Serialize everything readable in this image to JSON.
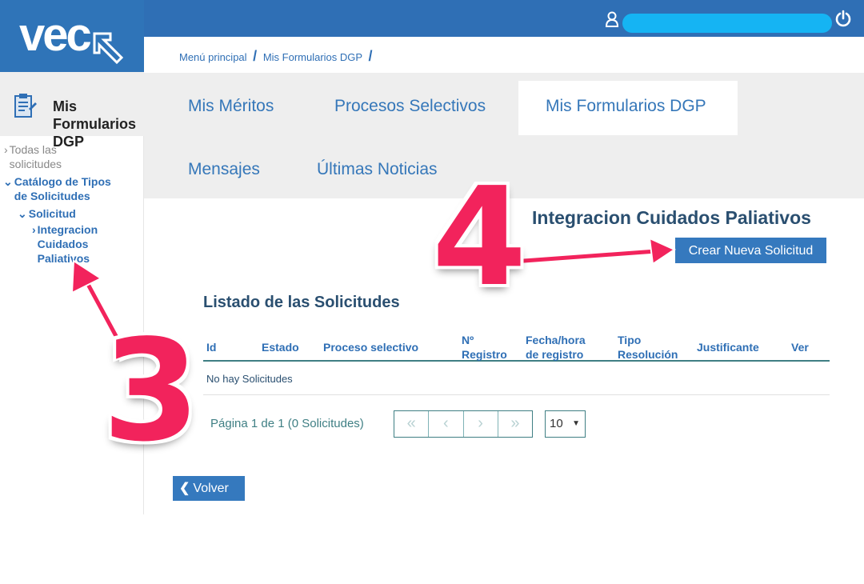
{
  "logo": {
    "text": "vec"
  },
  "sidebar": {
    "title": "Mis Formularios DGP",
    "items": [
      {
        "label": "Todas las solicitudes"
      },
      {
        "label": "Catálogo de Tipos de Solicitudes"
      },
      {
        "label": "Solicitud"
      },
      {
        "label": "Integracion Cuidados Paliativos"
      }
    ]
  },
  "breadcrumb": {
    "home": "Menú principal",
    "current": "Mis Formularios DGP",
    "sep": "/"
  },
  "tabs": [
    "Mis Méritos",
    "Procesos Selectivos",
    "Mis Formularios DGP",
    "Mensajes",
    "Últimas Noticias"
  ],
  "form": {
    "title": "Integracion Cuidados Paliativos",
    "create_label": "Crear Nueva Solicitud"
  },
  "list": {
    "title": "Listado de las Solicitudes",
    "columns": [
      "Id",
      "Estado",
      "Proceso selectivo",
      "Nº Registro",
      "Fecha/hora de registro",
      "Tipo Resolución",
      "Justificante",
      "Ver"
    ],
    "empty": "No hay Solicitudes"
  },
  "pagination": {
    "info": "Página 1 de 1 (0 Solicitudes)",
    "page_size": "10"
  },
  "back_label": "Volver",
  "annotations": {
    "step3": "3",
    "step4": "4"
  },
  "colors": {
    "brand": "#2f6fb5",
    "button": "#3579be",
    "annotation": "#f2235c",
    "scribble": "#15b4f3"
  }
}
